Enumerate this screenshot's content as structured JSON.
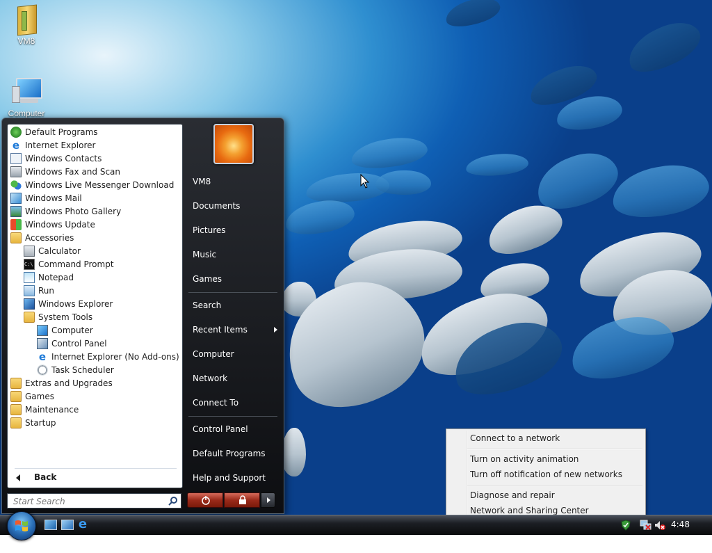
{
  "desktop": {
    "icons": [
      {
        "label": "VM8",
        "icon": "folder-icon"
      },
      {
        "label": "Computer",
        "icon": "computer-icon"
      }
    ]
  },
  "start_menu": {
    "programs": [
      {
        "label": "Default Programs",
        "icon": "default-programs-icon"
      },
      {
        "label": "Internet Explorer",
        "icon": "internet-explorer-icon"
      },
      {
        "label": "Windows Contacts",
        "icon": "contacts-icon"
      },
      {
        "label": "Windows Fax and Scan",
        "icon": "fax-icon"
      },
      {
        "label": "Windows Live Messenger Download",
        "icon": "messenger-icon"
      },
      {
        "label": "Windows Mail",
        "icon": "mail-icon"
      },
      {
        "label": "Windows Photo Gallery",
        "icon": "photo-gallery-icon"
      },
      {
        "label": "Windows Update",
        "icon": "windows-update-icon"
      },
      {
        "label": "Accessories",
        "icon": "folder-icon"
      },
      {
        "label": "Calculator",
        "icon": "calculator-icon"
      },
      {
        "label": "Command Prompt",
        "icon": "command-prompt-icon"
      },
      {
        "label": "Notepad",
        "icon": "notepad-icon"
      },
      {
        "label": "Run",
        "icon": "run-icon"
      },
      {
        "label": "Windows Explorer",
        "icon": "explorer-icon"
      },
      {
        "label": "System Tools",
        "icon": "folder-icon"
      },
      {
        "label": "Computer",
        "icon": "computer-icon"
      },
      {
        "label": "Control Panel",
        "icon": "control-panel-icon"
      },
      {
        "label": "Internet Explorer (No Add-ons)",
        "icon": "internet-explorer-icon"
      },
      {
        "label": "Task Scheduler",
        "icon": "task-scheduler-icon"
      },
      {
        "label": "Extras and Upgrades",
        "icon": "folder-icon"
      },
      {
        "label": "Games",
        "icon": "folder-icon"
      },
      {
        "label": "Maintenance",
        "icon": "folder-icon"
      },
      {
        "label": "Startup",
        "icon": "folder-icon"
      }
    ],
    "back_label": "Back",
    "search_placeholder": "Start Search",
    "right_items": [
      {
        "label": "VM8"
      },
      {
        "label": "Documents"
      },
      {
        "label": "Pictures"
      },
      {
        "label": "Music"
      },
      {
        "label": "Games"
      },
      {
        "label": "Search"
      },
      {
        "label": "Recent Items"
      },
      {
        "label": "Computer"
      },
      {
        "label": "Network"
      },
      {
        "label": "Connect To"
      },
      {
        "label": "Control Panel"
      },
      {
        "label": "Default Programs"
      },
      {
        "label": "Help and Support"
      }
    ]
  },
  "context_menu": {
    "items": [
      {
        "label": "Connect to a network"
      },
      {
        "label": "Turn on activity animation"
      },
      {
        "label": "Turn off notification of new networks"
      },
      {
        "label": "Diagnose and repair"
      },
      {
        "label": "Network and Sharing Center"
      }
    ]
  },
  "taskbar": {
    "clock": "4:48 AM",
    "quick_launch": [
      "show-desktop-icon",
      "switch-windows-icon",
      "internet-explorer-icon"
    ],
    "tray_icons": [
      "shield-icon",
      "network-icon",
      "volume-muted-icon"
    ]
  },
  "colors": {
    "menu_dark": "#0d0e11",
    "desktop_blue": "#0f5fb4",
    "menu_border": "#5a6a7a"
  }
}
